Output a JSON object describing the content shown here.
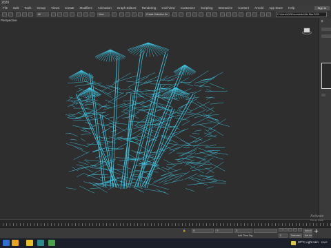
{
  "app": {
    "title": "2020"
  },
  "menu": [
    "File",
    "Edit",
    "Tools",
    "Group",
    "Views",
    "Create",
    "Modifiers",
    "Animation",
    "Graph Editors",
    "Rendering",
    "Civil View",
    "Customize",
    "Scripting",
    "Interactive",
    "Content",
    "Arnold",
    "App Store",
    "Help"
  ],
  "account": {
    "sign_in": "Sign In"
  },
  "toolbar": {
    "selection_filter": "All",
    "view_dropdown": "View",
    "named_selection": "Create Selection Se",
    "project_path": "C:\\Users\\KH\\Documents\\3ds Max 2020"
  },
  "viewport": {
    "label": "Perspective"
  },
  "statusbar": {
    "x_field": "X:",
    "y_field": "Y:",
    "z_field": "Z:",
    "key_mode": "Auto Key",
    "set_key": "Set Key",
    "selected_filter": "Selected",
    "add_time_tag": "Add Time Tag",
    "frame_counter": "0"
  },
  "watermark": {
    "line1": "Activate",
    "line2": "Go to Setti"
  },
  "taskbar": {
    "weather_temp": "20°C",
    "weather_desc": "Light rain",
    "language": "ENG"
  },
  "colors": {
    "wire": "#3fc8e6",
    "viewport_bg": "#2e2e2e",
    "taskbar": "#1b1f2a"
  }
}
